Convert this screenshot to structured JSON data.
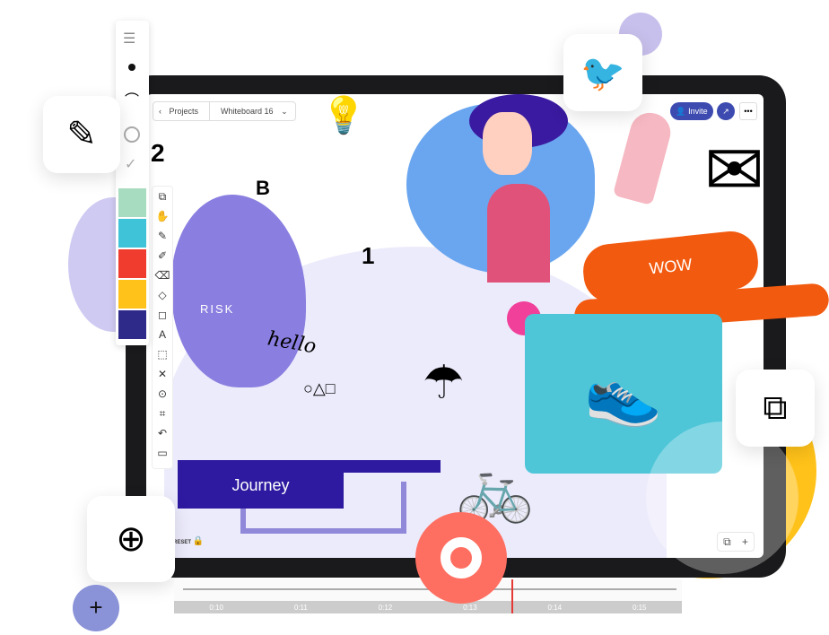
{
  "header": {
    "back_label": "Projects",
    "board_title": "Whiteboard 16",
    "invite_label": "Invite"
  },
  "canvas": {
    "banner_text": "Journey",
    "wow_text": "WOW",
    "doodle_hello": "hello",
    "doodle_risk": "RISK",
    "doodle_two": "2",
    "doodle_one": "1",
    "doodle_b": "B"
  },
  "bottom": {
    "reset_label": "RESET"
  },
  "timeline": {
    "ticks": [
      "0:10",
      "0:11",
      "0:12",
      "0:13",
      "0:14",
      "0:15"
    ],
    "playhead_position": "0:13.5"
  },
  "palette": {
    "colors": [
      "#a8dcc0",
      "#3fc3d8",
      "#f03c2e",
      "#ffc21a",
      "#2e2a8a"
    ]
  },
  "colors": {
    "accent": "#3d4bb0",
    "purple": "#8a7fe0",
    "orange": "#f25a0f",
    "teal": "#4ec6d8",
    "yellow": "#ffc21a",
    "coral": "#ff6f61"
  }
}
